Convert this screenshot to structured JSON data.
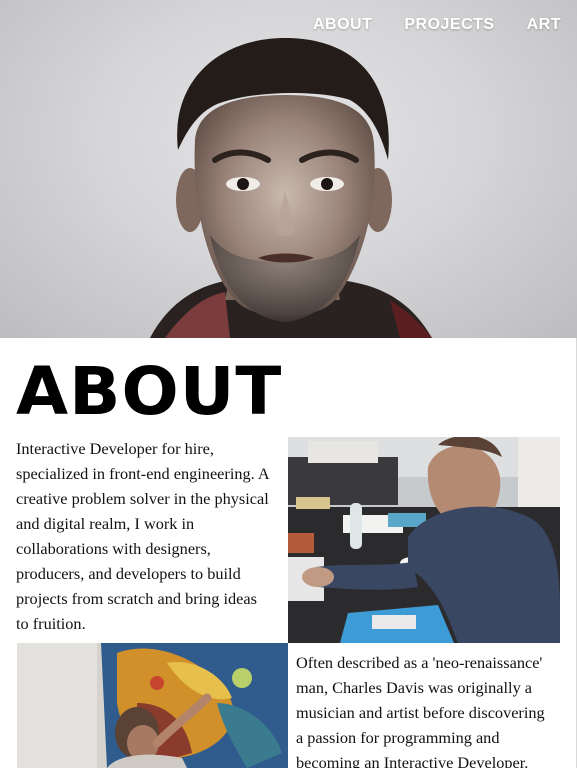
{
  "nav": {
    "items": [
      {
        "label": "ABOUT"
      },
      {
        "label": "PROJECTS"
      },
      {
        "label": "ART"
      }
    ]
  },
  "about": {
    "heading": "ABOUT",
    "paragraph1_lines": [
      "Interactive Developer for hire,",
      "specialized in front-end engineering. A",
      "creative problem solver in the physical",
      "and digital realm, I work in",
      "collaborations with designers,",
      "producers, and developers to build",
      "projects from scratch and bring ideas",
      "to fruition."
    ],
    "paragraph2_lines": [
      "Often described as a 'neo-renaissance'",
      "man, Charles Davis was originally a",
      "musician and artist before discovering",
      "a passion for programming and",
      "becoming an Interactive Developer."
    ]
  }
}
